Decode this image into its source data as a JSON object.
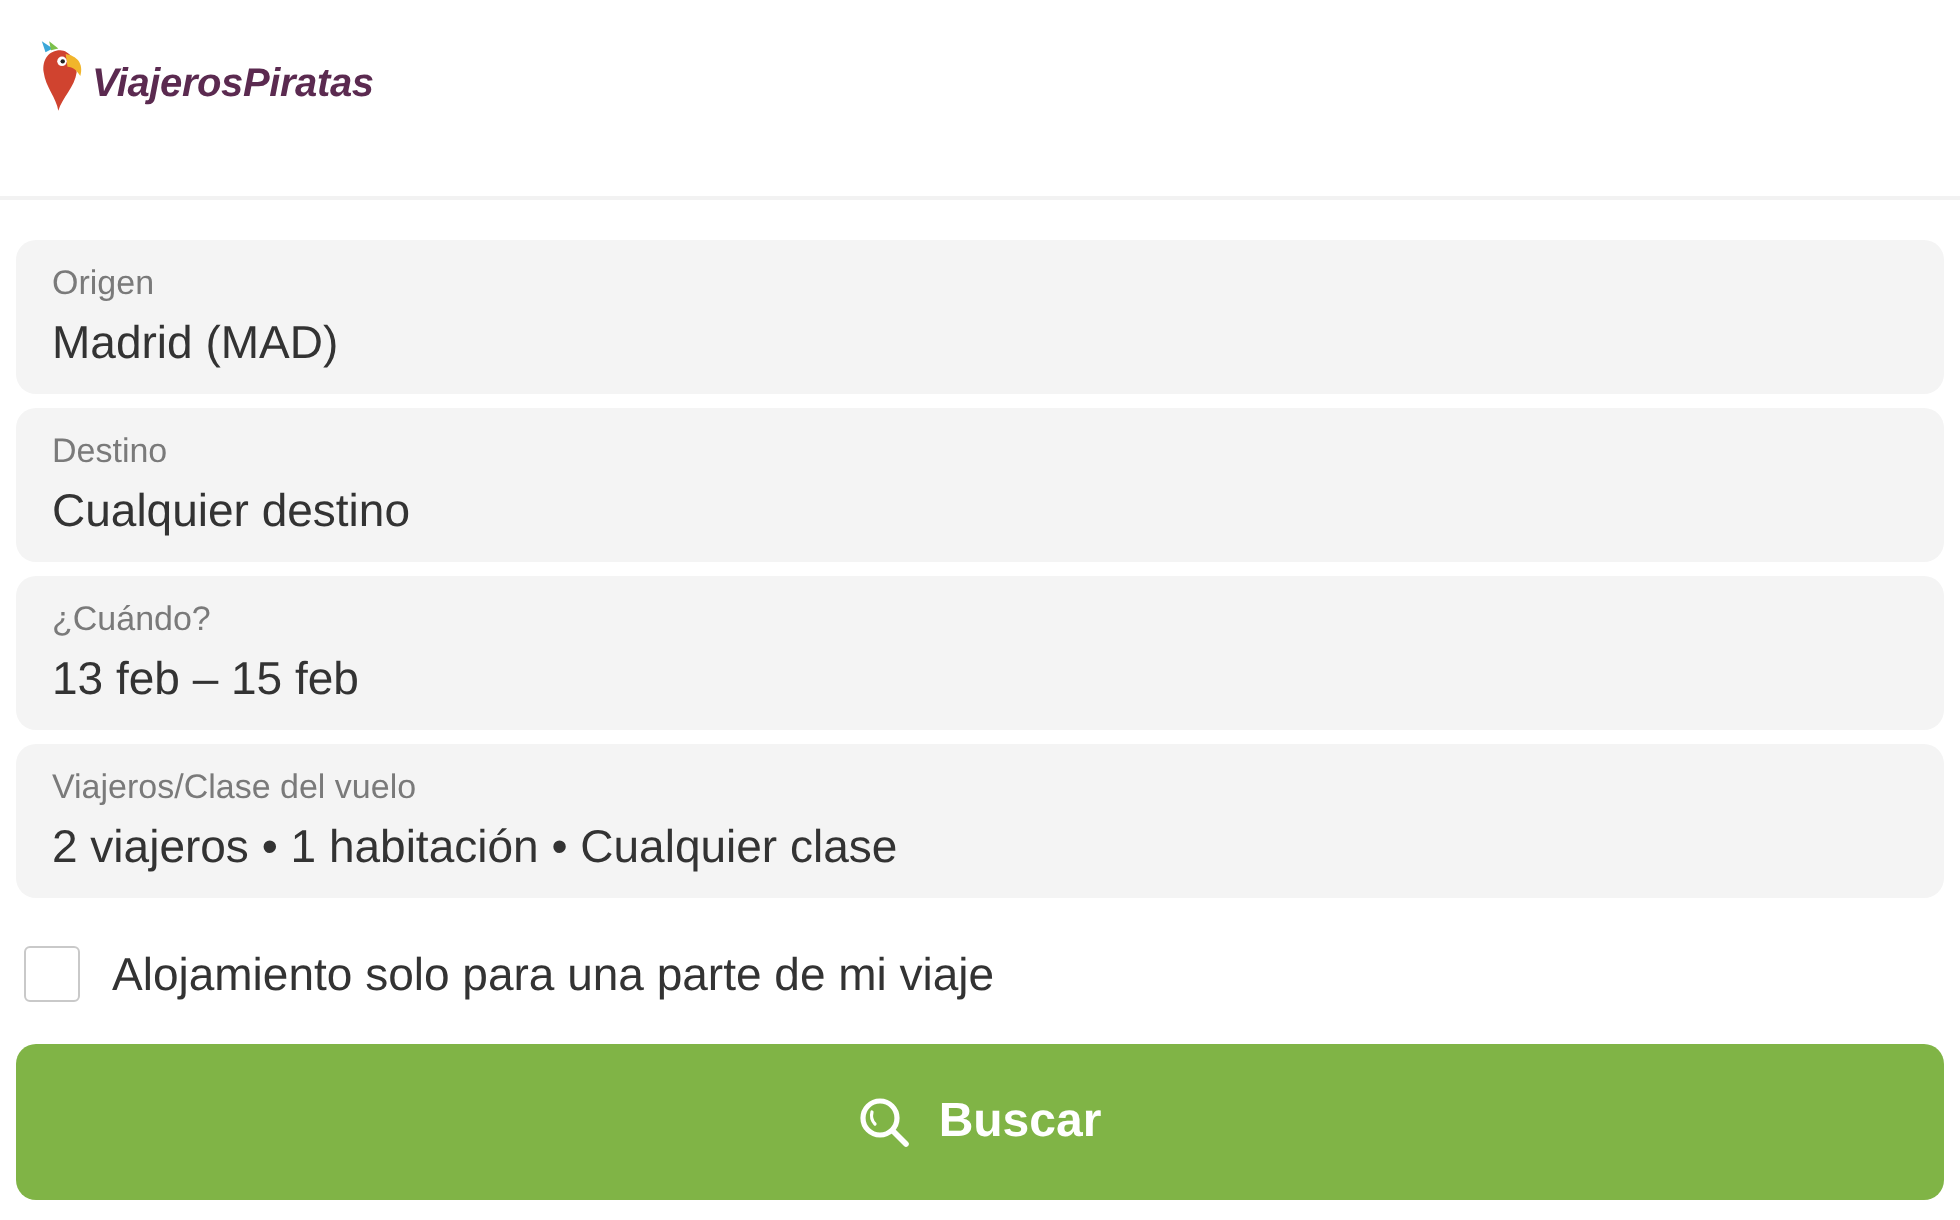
{
  "header": {
    "logo": {
      "text": "ViajerosPiratas"
    }
  },
  "fields": [
    {
      "label": "Origen",
      "value": "Madrid (MAD)"
    },
    {
      "label": "Destino",
      "value": "Cualquier destino"
    },
    {
      "label": "¿Cuándo?",
      "value": "13 feb – 15 feb"
    },
    {
      "label": "Viajeros/Clase del vuelo",
      "value": "2 viajeros • 1 habitación • Cualquier clase"
    }
  ],
  "option": {
    "label": "Alojamiento solo para una parte de mi viaje",
    "checked": false
  },
  "search_button": {
    "label": "Buscar"
  }
}
